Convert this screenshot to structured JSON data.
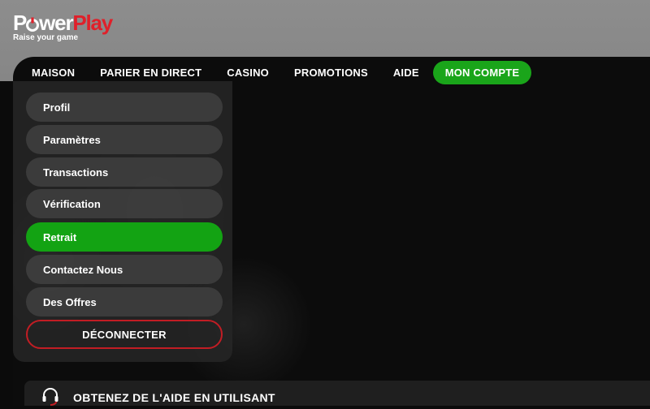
{
  "brand": {
    "name_part1": "P",
    "name_part1b": "wer",
    "name_part2": "Play",
    "tagline": "Raise your game"
  },
  "nav": {
    "items": [
      {
        "label": "MAISON"
      },
      {
        "label": "PARIER EN DIRECT"
      },
      {
        "label": "CASINO"
      },
      {
        "label": "PROMOTIONS"
      },
      {
        "label": "AIDE"
      },
      {
        "label": "MON COMPTE",
        "active": true
      }
    ]
  },
  "account_menu": {
    "items": [
      {
        "label": "Profil"
      },
      {
        "label": "Paramètres"
      },
      {
        "label": "Transactions"
      },
      {
        "label": "Vérification"
      },
      {
        "label": "Retrait",
        "active": true
      },
      {
        "label": "Contactez Nous"
      },
      {
        "label": "Des Offres"
      }
    ],
    "logout_label": "DÉCONNECTER"
  },
  "help": {
    "text": "OBTENEZ DE L'AIDE EN UTILISANT"
  },
  "colors": {
    "accent_green": "#13a313",
    "brand_red": "#e0202a",
    "logout_border": "#c21d24",
    "header_grey": "#8a8a8a"
  },
  "icons": {
    "logo_o": "power-button-icon",
    "help": "headset-icon"
  }
}
